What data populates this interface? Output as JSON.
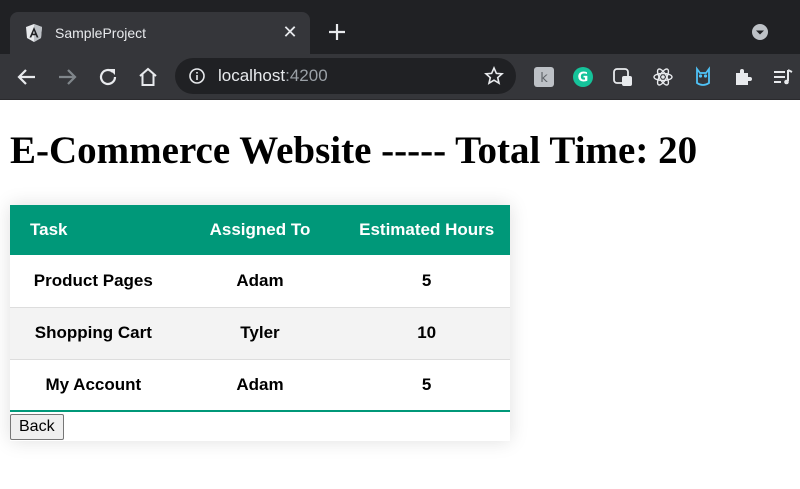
{
  "browser": {
    "tab": {
      "title": "SampleProject",
      "favicon": "angular-logo-icon",
      "close_glyph": "✕"
    },
    "new_tab_icon": "plus-icon",
    "omnibox": {
      "host": "localhost",
      "port": ":4200"
    },
    "extensions": [
      "ext-k-icon",
      "grammarly-icon",
      "ext-badge-icon",
      "react-devtools-icon",
      "ext-owl-icon",
      "puzzle-icon",
      "media-queue-icon"
    ]
  },
  "page": {
    "heading": "E-Commerce Website ----- Total Time: 20",
    "table": {
      "headers": [
        "Task",
        "Assigned To",
        "Estimated Hours"
      ],
      "rows": [
        [
          "Product Pages",
          "Adam",
          "5"
        ],
        [
          "Shopping Cart",
          "Tyler",
          "10"
        ],
        [
          "My Account",
          "Adam",
          "5"
        ]
      ],
      "header_color": "#009879"
    },
    "back_label": "Back"
  }
}
